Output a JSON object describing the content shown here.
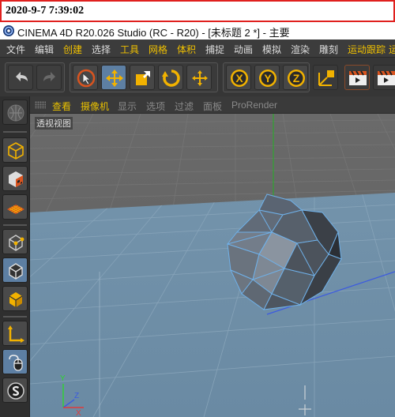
{
  "timestamp": "2020-9-7 7:39:02",
  "window": {
    "title": "CINEMA 4D R20.026 Studio (RC - R20) - [未标题 2 *] - 主要"
  },
  "menu": [
    {
      "label": "文件"
    },
    {
      "label": "编辑"
    },
    {
      "label": "创建"
    },
    {
      "label": "选择"
    },
    {
      "label": "工具"
    },
    {
      "label": "网格"
    },
    {
      "label": "体积"
    },
    {
      "label": "捕捉"
    },
    {
      "label": "动画"
    },
    {
      "label": "模拟"
    },
    {
      "label": "渲染"
    },
    {
      "label": "雕刻"
    },
    {
      "label": "运动跟踪"
    },
    {
      "label": "运"
    }
  ],
  "toolbar": {
    "icons": [
      "undo-icon",
      "redo-icon",
      "live-selection-icon",
      "move-icon",
      "scale-icon",
      "rotate-icon",
      "recent-tool-icon",
      "x-axis-lock-icon",
      "y-axis-lock-icon",
      "z-axis-lock-icon",
      "coordinate-system-icon",
      "render-view-icon",
      "render-picture-viewer-icon",
      "render-settings-icon"
    ],
    "axis_labels": [
      "X",
      "Y",
      "Z"
    ]
  },
  "viewport_menu": [
    {
      "label": "查看"
    },
    {
      "label": "摄像机"
    },
    {
      "label": "显示"
    },
    {
      "label": "选项"
    },
    {
      "label": "过滤"
    },
    {
      "label": "面板"
    },
    {
      "label": "ProRender"
    }
  ],
  "viewport": {
    "view_name": "透视视图",
    "axis_labels": [
      "Y",
      "Z",
      "X"
    ]
  },
  "colors": {
    "accent": "#e8c000",
    "active_tool": "#5d7fa3",
    "floor": "#6f8fa8",
    "highlight": "#e0201e"
  }
}
